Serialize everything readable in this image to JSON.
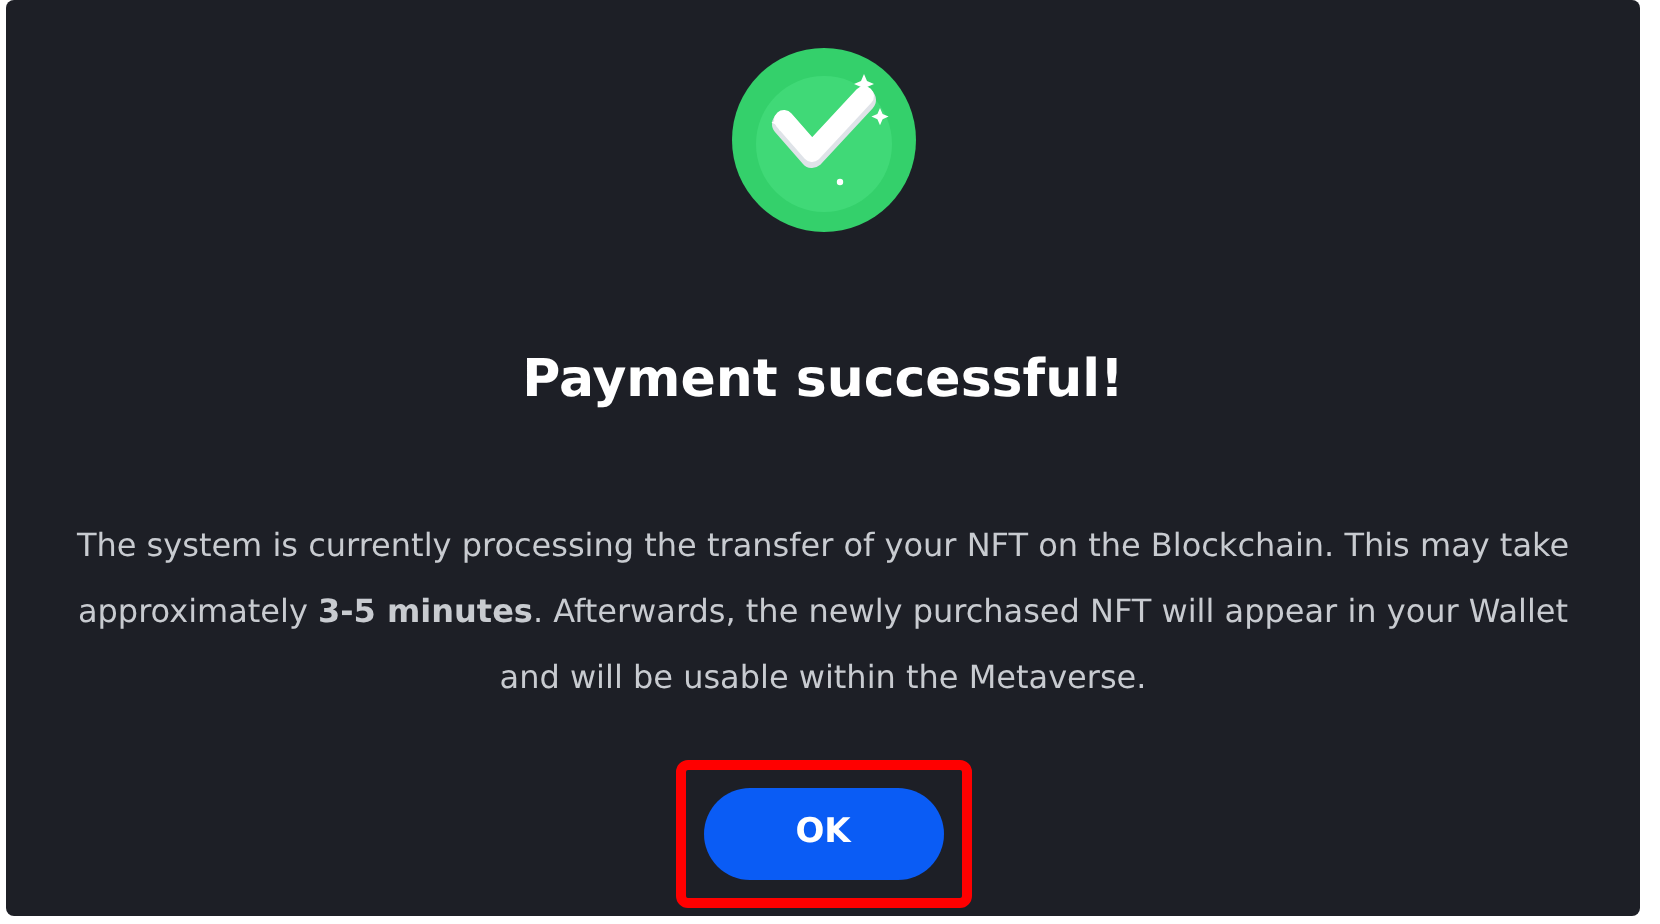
{
  "dialog": {
    "title": "Payment successful!",
    "message": "The system is currently processing the transfer of your NFT on the Blockchain. This may take approximately **3-5 minutes**. Afterwards, the newly purchased NFT will appear in your Wallet and will be usable within the Metaverse.",
    "button": {
      "label": "OK",
      "highlighted": true
    }
  }
}
